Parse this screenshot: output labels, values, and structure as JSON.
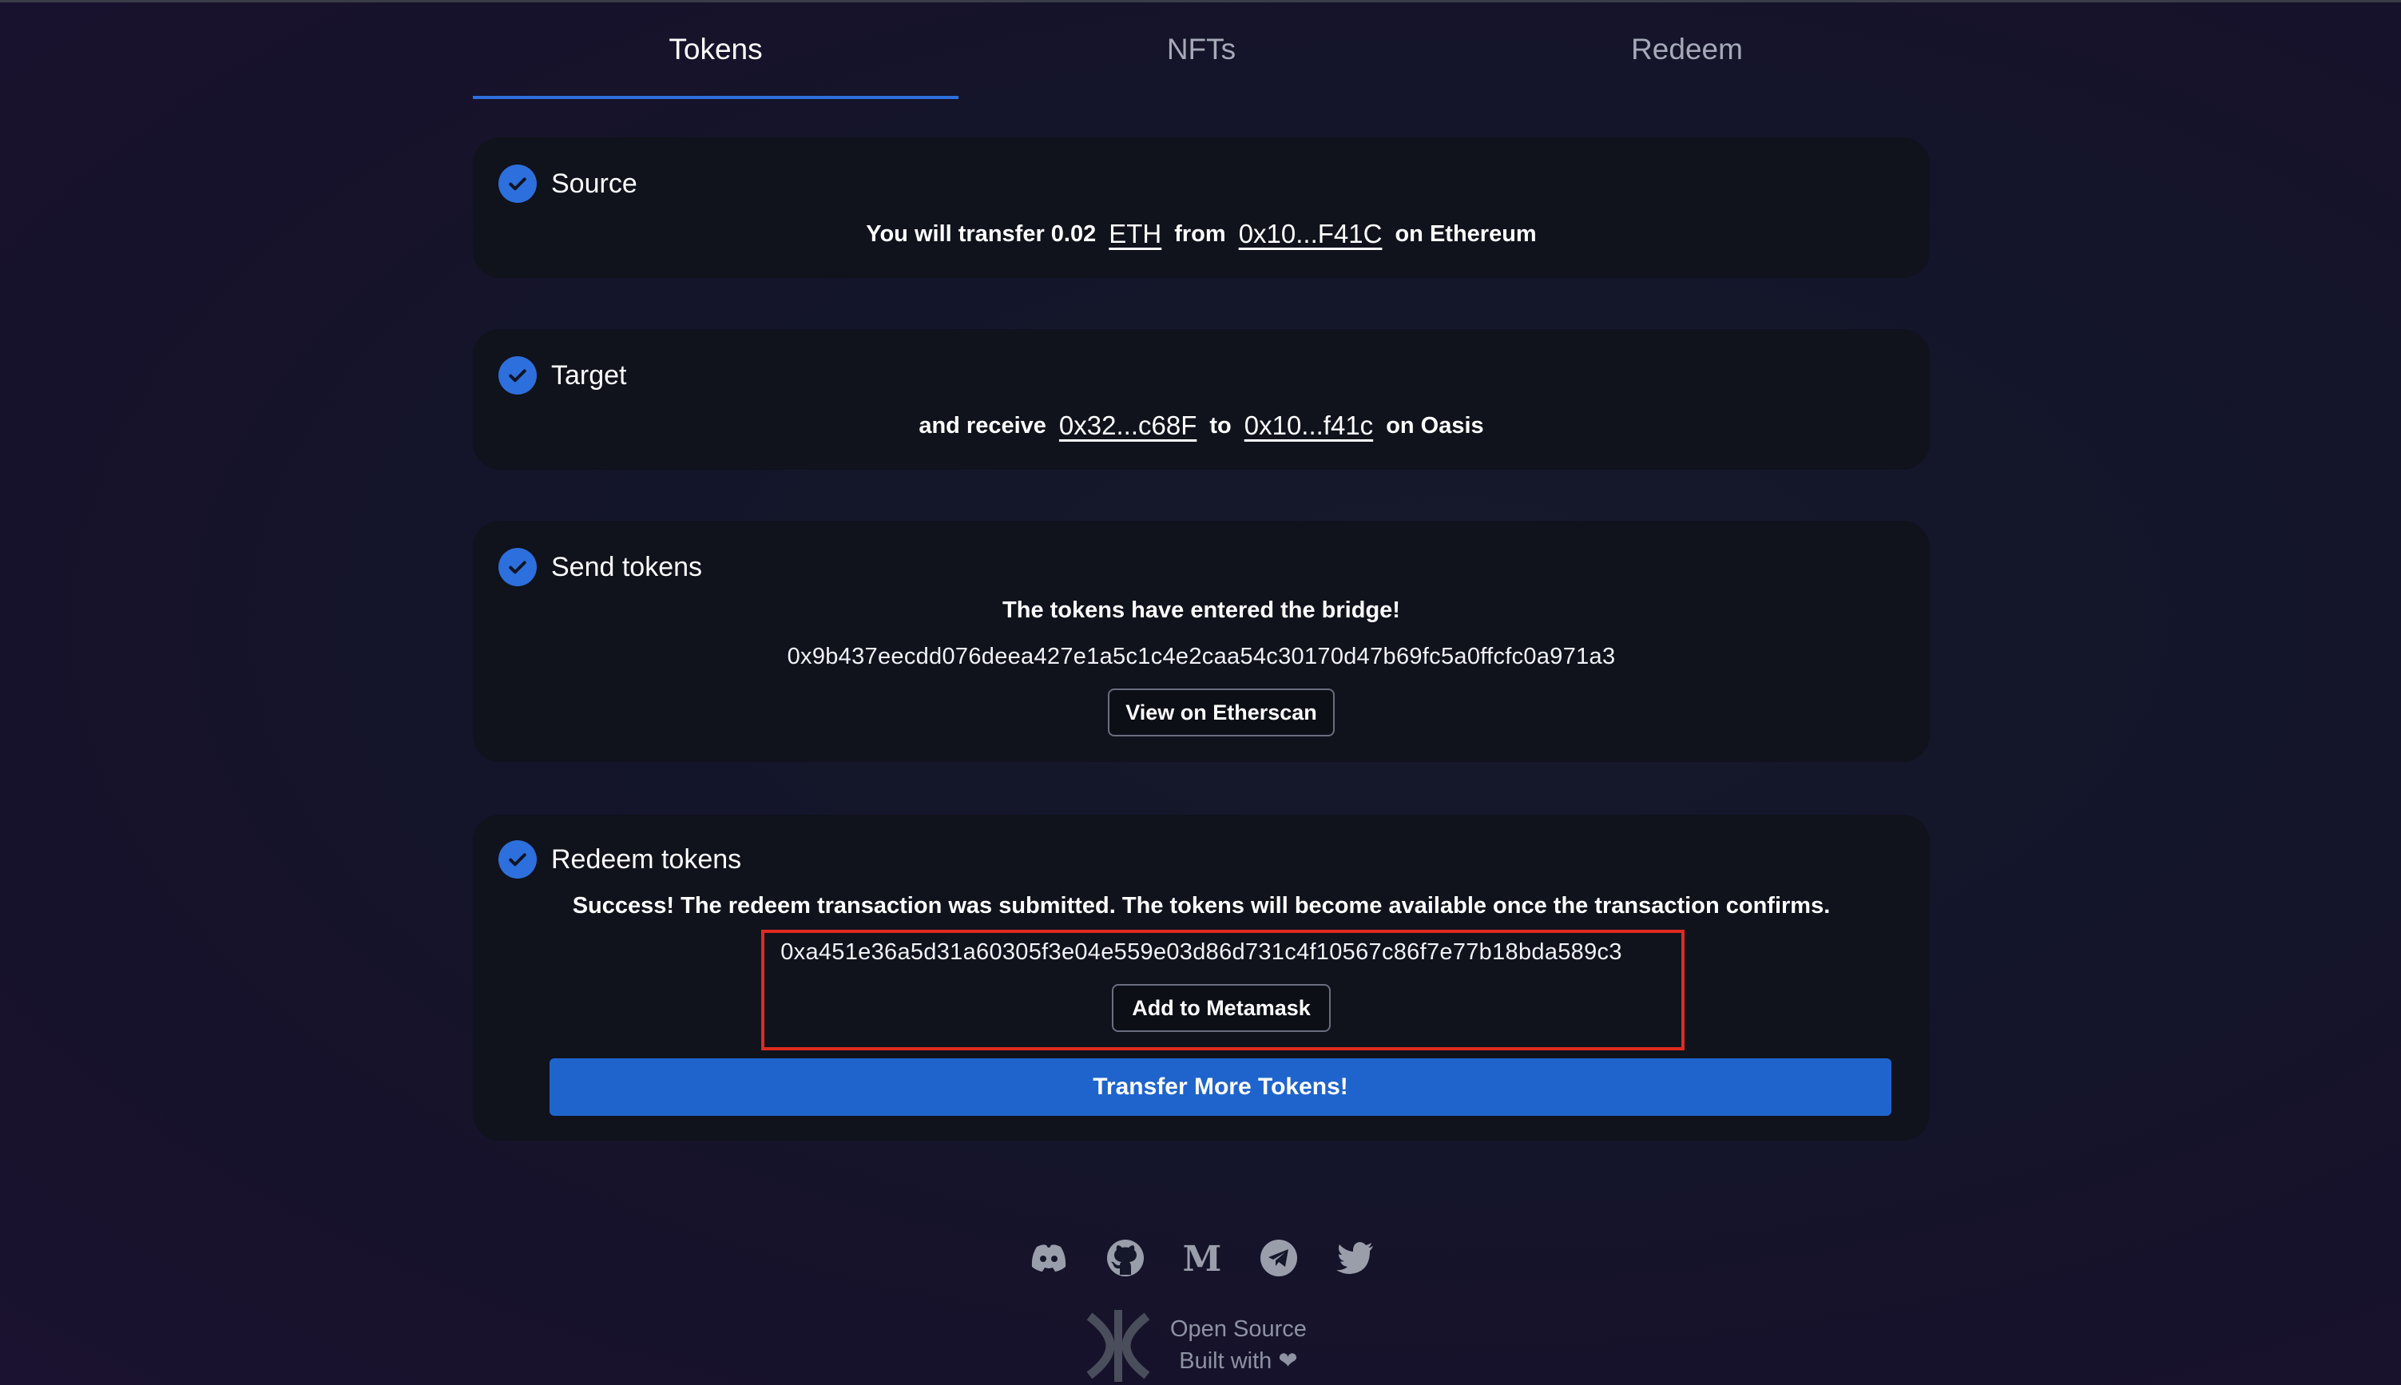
{
  "tabs": [
    {
      "label": "Tokens",
      "active": true
    },
    {
      "label": "NFTs",
      "active": false
    },
    {
      "label": "Redeem",
      "active": false
    }
  ],
  "source": {
    "title": "Source",
    "prefix": "You will transfer 0.02",
    "token": "ETH",
    "from_word": "from",
    "address": "0x10...F41C",
    "chain": "on Ethereum"
  },
  "target": {
    "title": "Target",
    "prefix": "and receive",
    "token_address": "0x32...c68F",
    "to_word": "to",
    "address": "0x10...f41c",
    "chain": "on Oasis"
  },
  "send": {
    "title": "Send tokens",
    "message": "The tokens have entered the bridge!",
    "tx_hash": "0x9b437eecdd076deea427e1a5c1c4e2caa54c30170d47b69fc5a0ffcfc0a971a3",
    "button": "View on Etherscan"
  },
  "redeem": {
    "title": "Redeem tokens",
    "message": "Success! The redeem transaction was submitted. The tokens will become available once the transaction confirms.",
    "token_address": "0xa451e36a5d31a60305f3e04e559e03d86d731c4f10567c86f7e77b18bda589c3",
    "add_button": "Add to Metamask",
    "transfer_button": "Transfer More Tokens!"
  },
  "footer": {
    "line1": "Open Source",
    "line2": "Built with ❤"
  },
  "colors": {
    "accent": "#2d6fdc",
    "primary_button": "#1f64cc",
    "highlight_box": "#e02b20"
  }
}
